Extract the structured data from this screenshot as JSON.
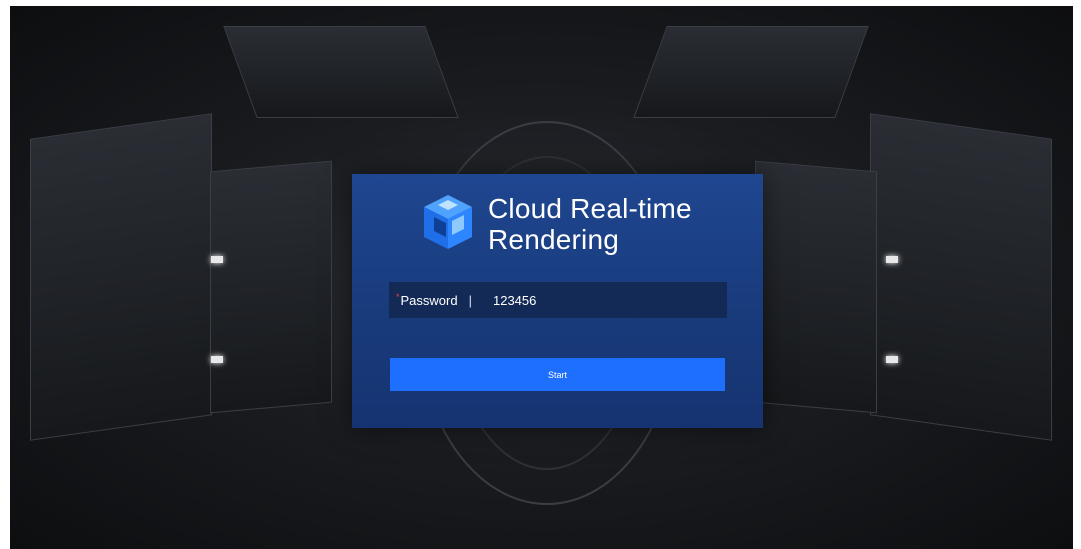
{
  "login": {
    "title": "Cloud Real-time Rendering",
    "password_label": "Password",
    "required_mark": "*",
    "separator": "|",
    "password_value": "123456",
    "start_label": "Start"
  },
  "colors": {
    "card_bg": "#1f4690",
    "field_bg": "#142a56",
    "button_bg": "#1f6fff",
    "required": "#e54545"
  },
  "icons": {
    "logo": "cube-logo-icon"
  }
}
